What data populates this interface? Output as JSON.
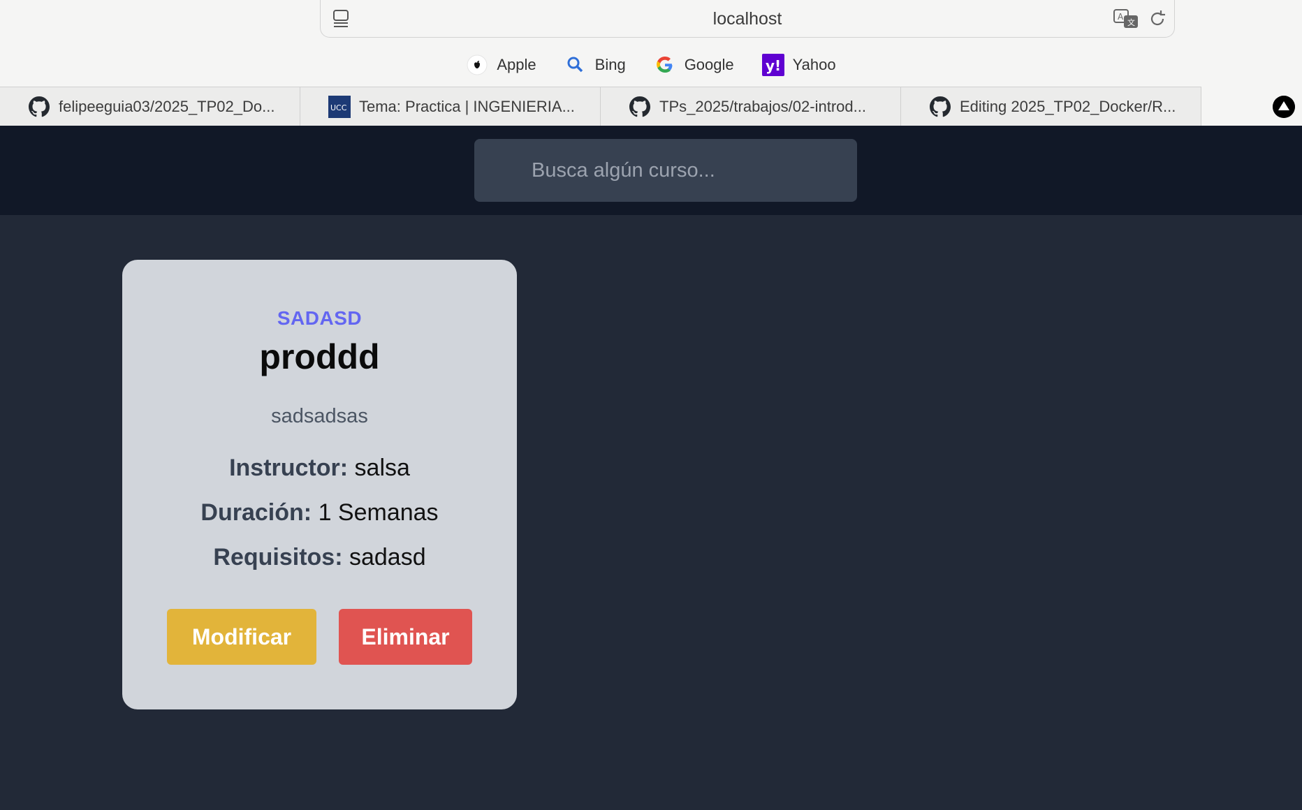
{
  "browser": {
    "url": "localhost",
    "favorites": [
      {
        "label": "Apple",
        "icon": "apple-icon"
      },
      {
        "label": "Bing",
        "icon": "bing-search-icon"
      },
      {
        "label": "Google",
        "icon": "google-icon"
      },
      {
        "label": "Yahoo",
        "icon": "yahoo-icon"
      }
    ],
    "tabs": [
      {
        "label": "felipeeguia03/2025_TP02_Do...",
        "icon": "github-icon"
      },
      {
        "label": "Tema: Practica | INGENIERIA...",
        "icon": "ucc-icon",
        "icon_text": "UCC"
      },
      {
        "label": "TPs_2025/trabajos/02-introd...",
        "icon": "github-icon"
      },
      {
        "label": "Editing 2025_TP02_Docker/R...",
        "icon": "github-icon"
      }
    ]
  },
  "search": {
    "placeholder": "Busca algún curso..."
  },
  "course": {
    "code": "SADASD",
    "title": "proddd",
    "description": "sadsadsas",
    "instructor_label": "Instructor:",
    "instructor": "salsa",
    "duration_label": "Duración:",
    "duration": "1 Semanas",
    "requirements_label": "Requisitos:",
    "requirements": "sadasd",
    "modify_label": "Modificar",
    "delete_label": "Eliminar"
  },
  "colors": {
    "header_bg": "#111827",
    "page_bg": "#222937",
    "card_bg": "#d1d5db",
    "accent": "#6366f1",
    "modify": "#e2b43a",
    "delete": "#e05451"
  }
}
